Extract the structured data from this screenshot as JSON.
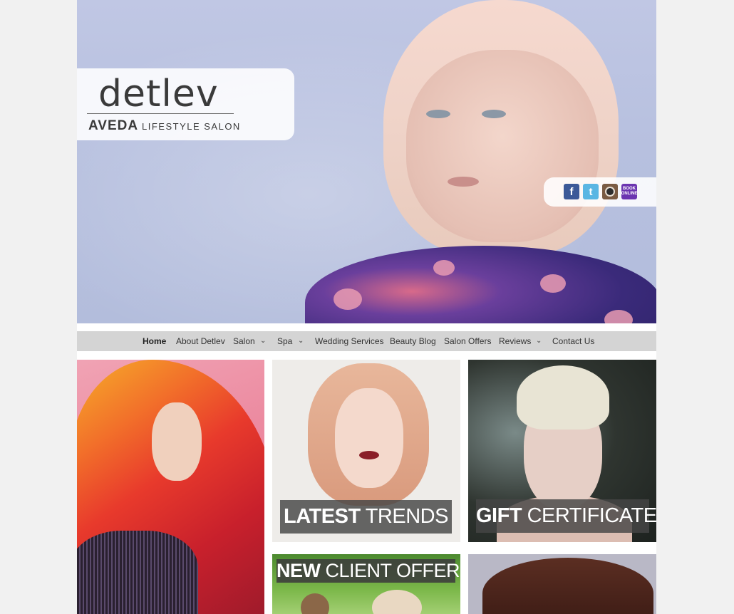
{
  "brand": {
    "name": "detlev",
    "partner": "AVEDA",
    "subtitle": "LIFESTYLE SALON"
  },
  "social": [
    {
      "name": "facebook",
      "glyph": "f"
    },
    {
      "name": "twitter",
      "glyph": "t"
    },
    {
      "name": "instagram",
      "glyph": ""
    },
    {
      "name": "book-online",
      "line1": "BOOK",
      "line2": "ONLINE"
    }
  ],
  "nav": {
    "items": [
      {
        "label": "Home",
        "active": true
      },
      {
        "label": "About Detlev"
      },
      {
        "label": "Salon",
        "dropdown": true
      },
      {
        "label": "Spa",
        "dropdown": true
      },
      {
        "label": "Wedding Services"
      },
      {
        "label": "Beauty Blog"
      },
      {
        "label": "Salon Offers"
      },
      {
        "label": "Reviews",
        "dropdown": true
      },
      {
        "label": "Contact Us"
      }
    ],
    "chevron": "⌄"
  },
  "tiles": {
    "latest_trends": {
      "bold": "LATEST",
      "regular": " TRENDS"
    },
    "gift_certificates": {
      "bold": "GIFT",
      "regular": " CERTIFICATES"
    },
    "new_client_offer": {
      "bold": "NEW",
      "regular": " CLIENT OFFER"
    }
  },
  "colors": {
    "page_bg": "#f1f1f1",
    "nav_bg": "#d4d4d4",
    "banner_bg": "#464646",
    "facebook": "#3b5998",
    "twitter": "#5ab6e3",
    "instagram": "#7a5b43",
    "book_online": "#6b35b0"
  }
}
